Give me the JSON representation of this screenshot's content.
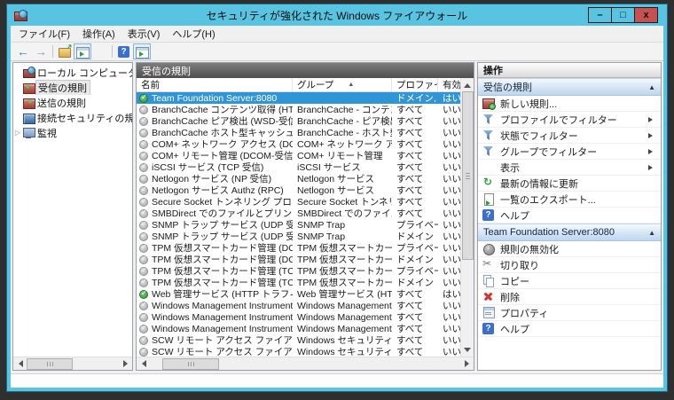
{
  "window": {
    "title": "セキュリティが強化された Windows ファイアウォール",
    "controls": {
      "minimize": "–",
      "maximize": "□",
      "close": "x"
    }
  },
  "menu": {
    "items": [
      {
        "id": "file",
        "label": "ファイル(F)"
      },
      {
        "id": "action",
        "label": "操作(A)"
      },
      {
        "id": "view",
        "label": "表示(V)"
      },
      {
        "id": "help",
        "label": "ヘルプ(H)"
      }
    ]
  },
  "toolbar": {
    "buttons": [
      {
        "name": "back",
        "active": false
      },
      {
        "name": "forward",
        "active": false
      },
      {
        "sep": true
      },
      {
        "name": "folder-up",
        "active": false
      },
      {
        "name": "console-tree",
        "active": true
      },
      {
        "name": "export-list",
        "active": false
      },
      {
        "sep": true
      },
      {
        "name": "help",
        "active": false
      },
      {
        "name": "action-pane",
        "active": true
      }
    ]
  },
  "tree": {
    "root": "ローカル コンピューター のセキュリテ",
    "expander_glyph": "▷",
    "items": [
      {
        "icon": "inbound",
        "label": "受信の規則",
        "selected": true
      },
      {
        "icon": "outbound",
        "label": "送信の規則",
        "selected": false
      },
      {
        "icon": "connsec",
        "label": "接続セキュリティの規則",
        "selected": false
      },
      {
        "icon": "monitor",
        "label": "監視",
        "selected": false,
        "expandable": true
      }
    ]
  },
  "list": {
    "title": "受信の規則",
    "columns": [
      "名前",
      "グループ",
      "プロファイル",
      "有効"
    ],
    "sort_indicator": "▲",
    "rows": [
      {
        "name": "Team Foundation Server:8080",
        "group": "",
        "profile": "ドメイン, プ...",
        "enabled": "はい",
        "state": "on",
        "selected": true
      },
      {
        "name": "BranchCache コンテンツ取得 (HTTP-受信)",
        "group": "BranchCache - コンテンツ取...",
        "profile": "すべて",
        "enabled": "いいえ",
        "state": "off",
        "selected": false
      },
      {
        "name": "BranchCache ピア検出 (WSD-受信)",
        "group": "BranchCache - ピア検出 (...",
        "profile": "すべて",
        "enabled": "いいえ",
        "state": "off",
        "selected": false
      },
      {
        "name": "BranchCache ホスト型キャッシュ サーバー (...",
        "group": "BranchCache - ホスト型キャ...",
        "profile": "すべて",
        "enabled": "いいえ",
        "state": "off",
        "selected": false
      },
      {
        "name": "COM+ ネットワーク アクセス (DCOM-受信)",
        "group": "COM+ ネットワーク アクセス",
        "profile": "すべて",
        "enabled": "いいえ",
        "state": "off",
        "selected": false
      },
      {
        "name": "COM+ リモート管理 (DCOM-受信)",
        "group": "COM+ リモート管理",
        "profile": "すべて",
        "enabled": "いいえ",
        "state": "off",
        "selected": false
      },
      {
        "name": "iSCSI サービス (TCP 受信)",
        "group": "iSCSI サービス",
        "profile": "すべて",
        "enabled": "いいえ",
        "state": "off",
        "selected": false
      },
      {
        "name": "Netlogon サービス (NP 受信)",
        "group": "Netlogon サービス",
        "profile": "すべて",
        "enabled": "いいえ",
        "state": "off",
        "selected": false
      },
      {
        "name": "Netlogon サービス Authz (RPC)",
        "group": "Netlogon サービス",
        "profile": "すべて",
        "enabled": "いいえ",
        "state": "off",
        "selected": false
      },
      {
        "name": "Secure Socket トンネリング プロトコル (SS...",
        "group": "Secure Socket トンネリング ...",
        "profile": "すべて",
        "enabled": "いいえ",
        "state": "off",
        "selected": false
      },
      {
        "name": "SMBDirect でのファイルとプリンターの共有 (...",
        "group": "SMBDirect でのファイルとプリ...",
        "profile": "すべて",
        "enabled": "いいえ",
        "state": "off",
        "selected": false
      },
      {
        "name": "SNMP トラップ サービス (UDP 受信)",
        "group": "SNMP Trap",
        "profile": "プライベー...",
        "enabled": "いいえ",
        "state": "off",
        "selected": false
      },
      {
        "name": "SNMP トラップ サービス (UDP 受信)",
        "group": "SNMP Trap",
        "profile": "ドメイン",
        "enabled": "いいえ",
        "state": "off",
        "selected": false
      },
      {
        "name": "TPM 仮想スマートカード管理 (DCOM 受信)",
        "group": "TPM 仮想スマートカード管理",
        "profile": "プライベー...",
        "enabled": "いいえ",
        "state": "off",
        "selected": false
      },
      {
        "name": "TPM 仮想スマートカード管理 (DCOM 受信)",
        "group": "TPM 仮想スマートカード管理",
        "profile": "ドメイン",
        "enabled": "いいえ",
        "state": "off",
        "selected": false
      },
      {
        "name": "TPM 仮想スマートカード管理 (TCP 受信)",
        "group": "TPM 仮想スマートカード管理",
        "profile": "プライベー...",
        "enabled": "いいえ",
        "state": "off",
        "selected": false
      },
      {
        "name": "TPM 仮想スマートカード管理 (TCP 受信)",
        "group": "TPM 仮想スマートカード管理",
        "profile": "ドメイン",
        "enabled": "いいえ",
        "state": "off",
        "selected": false
      },
      {
        "name": "Web 管理サービス (HTTP トラフィック)",
        "group": "Web 管理サービス (HTTP)",
        "profile": "すべて",
        "enabled": "はい",
        "state": "on",
        "selected": false
      },
      {
        "name": "Windows Management Instrumentat...",
        "group": "Windows Management I...",
        "profile": "すべて",
        "enabled": "いいえ",
        "state": "off",
        "selected": false
      },
      {
        "name": "Windows Management Instrumentat...",
        "group": "Windows Management I...",
        "profile": "すべて",
        "enabled": "いいえ",
        "state": "off",
        "selected": false
      },
      {
        "name": "Windows Management Instrumentat...",
        "group": "Windows Management I...",
        "profile": "すべて",
        "enabled": "いいえ",
        "state": "off",
        "selected": false
      },
      {
        "name": "SCW リモート アクセス ファイアウォール規則 -...",
        "group": "Windows セキュリティの構成...",
        "profile": "すべて",
        "enabled": "いいえ",
        "state": "off",
        "selected": false
      },
      {
        "name": "SCW リモート アクセス ファイアウォール規則 -...",
        "group": "Windows セキュリティの構成...",
        "profile": "すべて",
        "enabled": "いいえ",
        "state": "off",
        "selected": false
      },
      {
        "name": "SCW リモート アクセス ファイアウォール規則 -...",
        "group": "Windows セキュリティの構成",
        "profile": "すべて",
        "enabled": "いいえ",
        "state": "off",
        "selected": false
      }
    ]
  },
  "actions": {
    "title": "操作",
    "collapse_glyph": "▲",
    "sections": [
      {
        "header": "受信の規則",
        "items": [
          {
            "icon": "new-rule",
            "label": "新しい規則...",
            "submenu": false
          },
          {
            "icon": "filter",
            "label": "プロファイルでフィルター",
            "submenu": true
          },
          {
            "icon": "filter",
            "label": "状態でフィルター",
            "submenu": true
          },
          {
            "icon": "filter",
            "label": "グループでフィルター",
            "submenu": true
          },
          {
            "icon": "",
            "label": "表示",
            "submenu": true
          },
          {
            "icon": "refresh",
            "label": "最新の情報に更新",
            "submenu": false
          },
          {
            "icon": "export",
            "label": "一覧のエクスポート...",
            "submenu": false
          },
          {
            "icon": "help",
            "label": "ヘルプ",
            "submenu": false
          }
        ]
      },
      {
        "header": "Team Foundation Server:8080",
        "items": [
          {
            "icon": "disable-rule",
            "label": "規則の無効化",
            "submenu": false
          },
          {
            "icon": "cut",
            "label": "切り取り",
            "submenu": false
          },
          {
            "icon": "copy",
            "label": "コピー",
            "submenu": false
          },
          {
            "icon": "delete",
            "label": "削除",
            "submenu": false
          },
          {
            "icon": "properties",
            "label": "プロパティ",
            "submenu": false
          },
          {
            "icon": "help",
            "label": "ヘルプ",
            "submenu": false
          }
        ]
      }
    ]
  },
  "colors": {
    "titlebar_blue": "#58c4e1",
    "close_red": "#c75050",
    "selection_blue": "#3095d6",
    "enabled_green": "#2f8f2f",
    "disabled_gray": "#a6a6a6"
  }
}
